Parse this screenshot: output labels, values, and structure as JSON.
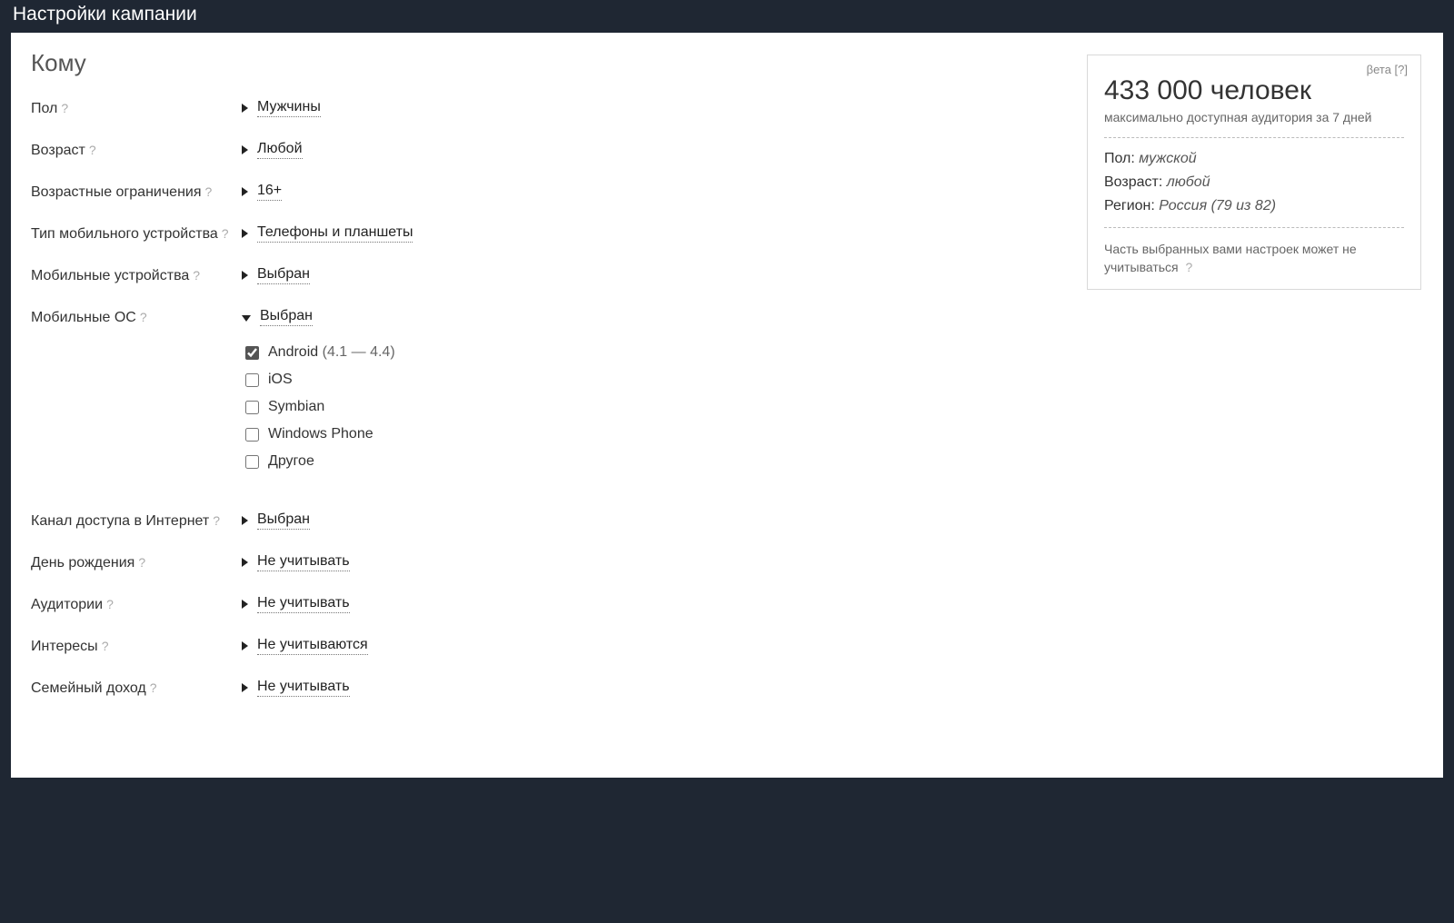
{
  "titlebar": "Настройки кампании",
  "section_title": "Кому",
  "hint_symbol": "?",
  "rows": {
    "gender": {
      "label": "Пол",
      "value": "Мужчины",
      "expanded": false
    },
    "age": {
      "label": "Возраст",
      "value": "Любой",
      "expanded": false
    },
    "age_limit": {
      "label": "Возрастные ограничения",
      "value": "16+",
      "expanded": false
    },
    "device_type": {
      "label": "Тип мобильного устройства",
      "value": "Телефоны и планшеты",
      "expanded": false
    },
    "devices": {
      "label": "Мобильные устройства",
      "value": "Выбран",
      "expanded": false
    },
    "mobile_os": {
      "label": "Мобильные ОС",
      "value": "Выбран",
      "expanded": true
    },
    "channel": {
      "label": "Канал доступа в Интернет",
      "value": "Выбран",
      "expanded": false
    },
    "birthday": {
      "label": "День рождения",
      "value": "Не учитывать",
      "expanded": false
    },
    "audiences": {
      "label": "Аудитории",
      "value": "Не учитывать",
      "expanded": false
    },
    "interests": {
      "label": "Интересы",
      "value": "Не учитываются",
      "expanded": false
    },
    "income": {
      "label": "Семейный доход",
      "value": "Не учитывать",
      "expanded": false
    }
  },
  "mobile_os_options": {
    "android": {
      "label": "Android",
      "extra": "(4.1 — 4.4)",
      "checked": true
    },
    "ios": {
      "label": "iOS",
      "checked": false
    },
    "symbian": {
      "label": "Symbian",
      "checked": false
    },
    "wp": {
      "label": "Windows Phone",
      "checked": false
    },
    "other": {
      "label": "Другое",
      "checked": false
    }
  },
  "sidebox": {
    "beta": "βета [?]",
    "headline": "433 000 человек",
    "subline": "максимально доступная аудитория за 7 дней",
    "gender_label": "Пол:",
    "gender_value": "мужской",
    "age_label": "Возраст:",
    "age_value": "любой",
    "region_label": "Регион:",
    "region_value": "Россия (79 из 82)",
    "note": "Часть выбранных вами настроек может не учитываться"
  }
}
